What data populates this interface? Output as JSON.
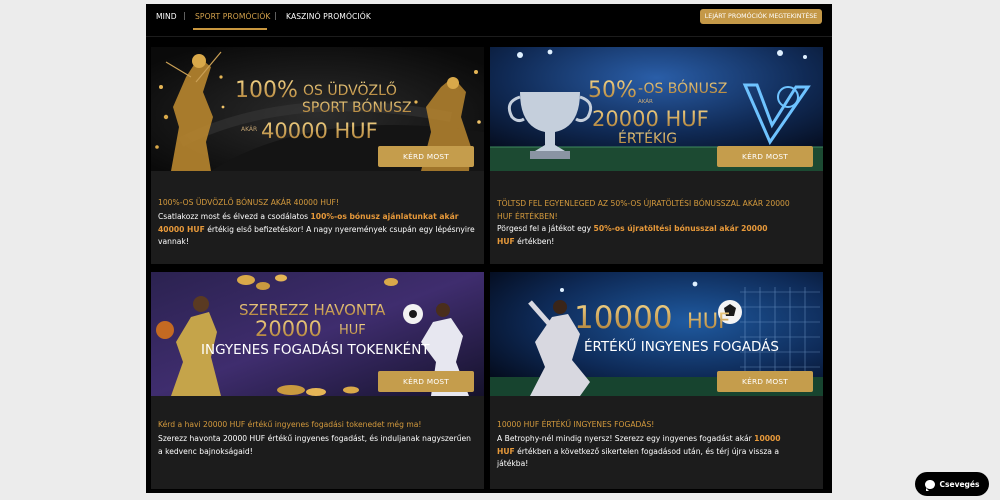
{
  "nav": {
    "tabs": [
      {
        "label": "MIND"
      },
      {
        "label": "SPORT PROMÓCIÓK"
      },
      {
        "label": "KASZINÓ PROMÓCIÓK"
      }
    ],
    "separator": "|",
    "expired_button": "LEJÁRT PROMÓCIÓK MEGTEKINTÉSE"
  },
  "cards": [
    {
      "banner": {
        "line1_big": "100%",
        "line1_small": "OS ÜDVÖZLŐ",
        "line2": "SPORT BÓNUSZ",
        "akar": "AKÁR",
        "amount": "40000 HUF"
      },
      "button": "KÉRD MOST",
      "title": "100%-OS ÜDVÖZLŐ BÓNUSZ AKÁR 40000 HUF!",
      "body": {
        "t1": "Csatlakozz most és élvezd a csodálatos ",
        "h1": "100%-os bónusz ajánlatunkat akár 40000 HUF",
        "t2": " értékig első befizetéskor! A nagy nyeremények csupán egy lépésnyire vannak!"
      }
    },
    {
      "banner": {
        "line1_big": "50%",
        "line1_small": "-OS BÓNUSZ",
        "akar": "AKÁR",
        "amount": "20000 HUF",
        "line3": "ÉRTÉKIG"
      },
      "button": "KÉRD MOST",
      "title_l1": "TÖLTSD FEL EGYENLEGED AZ 50%-OS ÚJRATÖLTÉSI BÓNUSSZAL AKÁR 20000",
      "title_l2": "HUF ÉRTÉKBEN!",
      "body": {
        "t1": "Pörgesd fel a játékot egy ",
        "h1": "50%-os újratöltési bónusszal akár 20000 HUF",
        "t2": " értékben!"
      }
    },
    {
      "banner": {
        "line1": "SZEREZZ HAVONTA",
        "amount_big": "20000",
        "amount_small": "HUF",
        "line3": "INGYENES FOGADÁSI TOKENKÉNT"
      },
      "button": "KÉRD MOST",
      "title": "Kérd a havi 20000 HUF értékű ingyenes fogadási tokenedet még ma!",
      "body": {
        "t1": "Szerezz havonta 20000 HUF értékű ingyenes fogadást, és induljanak nagyszerűen a kedvenc bajnokságaid!"
      }
    },
    {
      "banner": {
        "amount_big": "10000",
        "amount_small": "HUF",
        "line2": "ÉRTÉKŰ INGYENES FOGADÁS"
      },
      "button": "KÉRD MOST",
      "title": "10000 HUF ÉRTÉKŰ INGYENES FOGADÁS!",
      "body": {
        "t1": "A Betrophy-nél mindig nyersz! Szerezz egy ingyenes fogadást akár ",
        "h1": "10000 HUF",
        "t2": " értékben a következő sikertelen fogadásod után, és térj újra vissza a játékba!"
      }
    }
  ],
  "chat": {
    "label": "Csevegés"
  },
  "colors": {
    "gold": "#c59d4c",
    "accent_orange": "#d49a3d",
    "card_bg": "#1c1c1c"
  }
}
